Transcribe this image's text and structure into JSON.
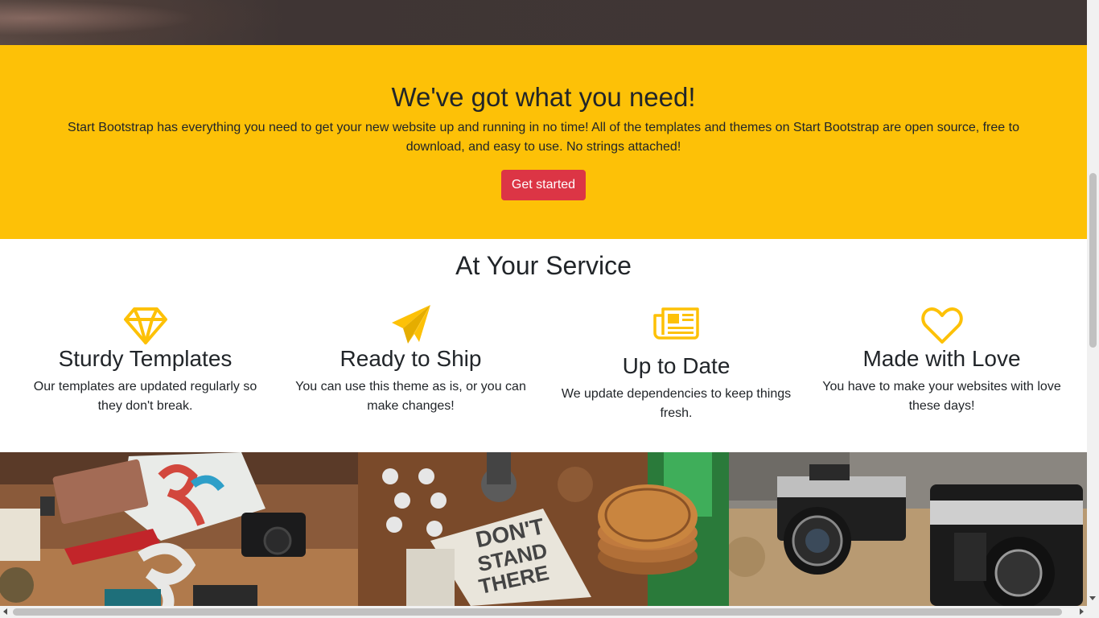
{
  "callout": {
    "title": "We've got what you need!",
    "text": "Start Bootstrap has everything you need to get your new website up and running in no time! All of the templates and themes on Start Bootstrap are open source, free to download, and easy to use. No strings attached!",
    "button_label": "Get started"
  },
  "services": {
    "title": "At Your Service",
    "items": [
      {
        "icon": "diamond-icon",
        "title": "Sturdy Templates",
        "text": "Our templates are updated regularly so they don't break."
      },
      {
        "icon": "paper-plane-icon",
        "title": "Ready to Ship",
        "text": "You can use this theme as is, or you can make changes!"
      },
      {
        "icon": "newspaper-icon",
        "title": "Up to Date",
        "text": "We update dependencies to keep things fresh."
      },
      {
        "icon": "heart-icon",
        "title": "Made with Love",
        "text": "You have to make your websites with love these days!"
      }
    ]
  },
  "portfolio": {
    "tiles": [
      {
        "name": "portfolio-image-workspace-desk"
      },
      {
        "name": "portfolio-image-coasters-cards"
      },
      {
        "name": "portfolio-image-cameras"
      }
    ]
  },
  "colors": {
    "accent_yellow": "#fdc107",
    "button_red": "#dc3545",
    "text_dark": "#212529"
  }
}
